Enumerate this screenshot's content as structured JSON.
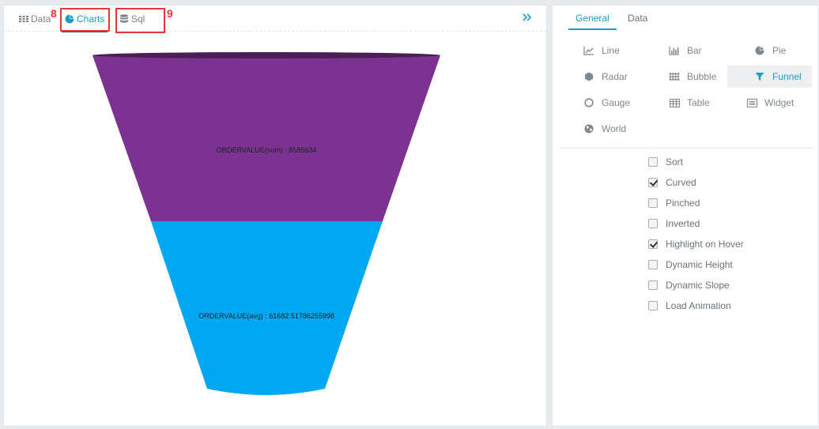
{
  "left_tabs": {
    "data": "Data",
    "charts": "Charts",
    "sql": "Sql"
  },
  "annotations": {
    "charts_num": "8",
    "sql_num": "9"
  },
  "funnel": {
    "stages": [
      {
        "label": "ORDERVALUE(sum) : 8585634",
        "color": "#7b3290"
      },
      {
        "label": "ORDERVALUE(avg) : 61682.51786255998",
        "color": "#00a8f3"
      }
    ],
    "top_ellipse_color": "#4b1e57"
  },
  "right_tabs": {
    "general": "General",
    "data": "Data"
  },
  "chart_types": [
    {
      "label": "Line",
      "icon": "line-chart-icon"
    },
    {
      "label": "Bar",
      "icon": "bar-chart-icon"
    },
    {
      "label": "Pie",
      "icon": "pie-chart-icon"
    },
    {
      "label": "Radar",
      "icon": "radar-icon"
    },
    {
      "label": "Bubble",
      "icon": "bubble-icon"
    },
    {
      "label": "Funnel",
      "icon": "funnel-icon",
      "active": true
    },
    {
      "label": "Gauge",
      "icon": "gauge-icon"
    },
    {
      "label": "Table",
      "icon": "table-icon"
    },
    {
      "label": "Widget",
      "icon": "widget-icon"
    },
    {
      "label": "World",
      "icon": "globe-icon"
    }
  ],
  "options": [
    {
      "label": "Sort",
      "checked": false
    },
    {
      "label": "Curved",
      "checked": true
    },
    {
      "label": "Pinched",
      "checked": false
    },
    {
      "label": "Inverted",
      "checked": false
    },
    {
      "label": "Highlight on Hover",
      "checked": true
    },
    {
      "label": "Dynamic Height",
      "checked": false
    },
    {
      "label": "Dynamic Slope",
      "checked": false
    },
    {
      "label": "Load Animation",
      "checked": false
    }
  ],
  "colors": {
    "accent": "#1a9ec6",
    "annotation_red": "#e53935"
  }
}
